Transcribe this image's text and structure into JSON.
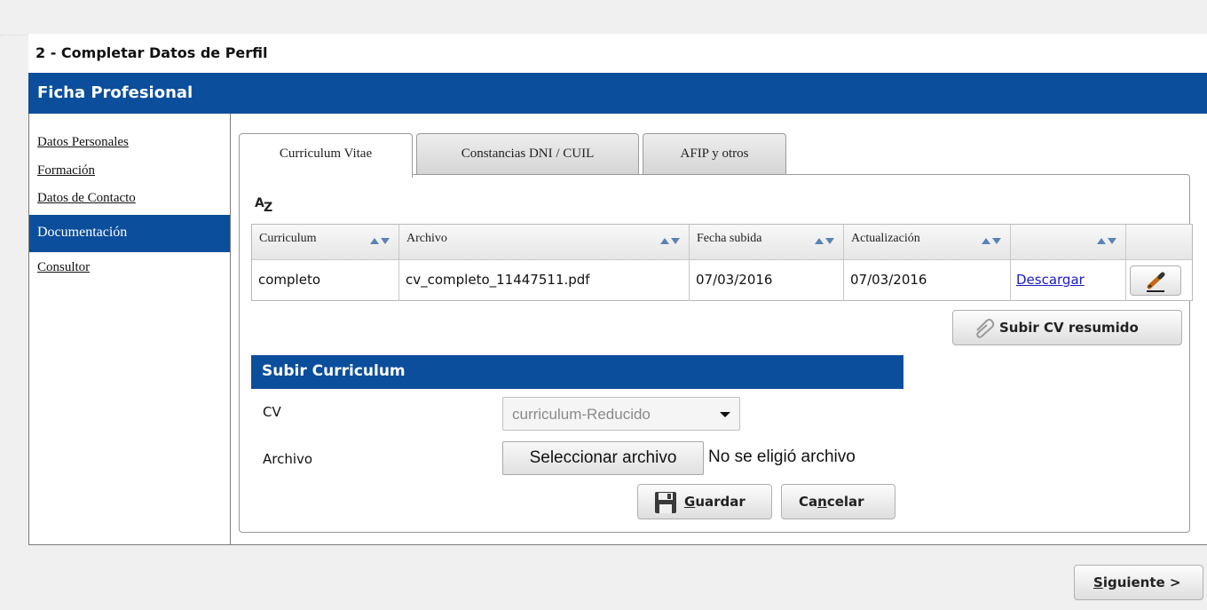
{
  "step": {
    "title": "2 - Completar Datos de Perfil"
  },
  "ficha": {
    "title": "Ficha Profesional"
  },
  "sidebar": {
    "items": [
      {
        "label": "Datos Personales",
        "active": false
      },
      {
        "label": "Formación",
        "active": false
      },
      {
        "label": "Datos de Contacto",
        "active": false
      },
      {
        "label": "Documentación",
        "active": true
      },
      {
        "label": "Consultor",
        "active": false
      }
    ]
  },
  "tabs": [
    {
      "label": "Curriculum Vitae",
      "active": true
    },
    {
      "label": "Constancias DNI / CUIL",
      "active": false
    },
    {
      "label": "AFIP y otros",
      "active": false
    }
  ],
  "grid": {
    "sort_icon": "az-sort-icon",
    "columns": [
      "Curriculum",
      "Archivo",
      "Fecha subida",
      "Actualización",
      "",
      ""
    ],
    "rows": [
      {
        "curriculum": "completo",
        "archivo": "cv_completo_11447511.pdf",
        "fecha_subida": "07/03/2016",
        "actualizacion": "07/03/2016",
        "descargar": "Descargar",
        "edit_icon": "pencil-icon"
      }
    ]
  },
  "subir_cv_resumido": {
    "label": "Subir CV resumido",
    "icon": "paperclip-icon"
  },
  "subir_curriculum": {
    "title": "Subir Curriculum",
    "cv_label": "CV",
    "cv_selected": "curriculum-Reducido",
    "archivo_label": "Archivo",
    "file_button": "Seleccionar archivo",
    "file_status": "No se eligió archivo"
  },
  "actions": {
    "guardar_prefix": "G",
    "guardar_rest": "uardar",
    "guardar_icon": "floppy-disk-icon",
    "cancelar_pre": "Ca",
    "cancelar_u": "n",
    "cancelar_post": "celar"
  },
  "siguiente": {
    "underline": "S",
    "rest": "iguiente >"
  },
  "colors": {
    "primary_blue": "#0b4e9c",
    "link_blue": "#1a1acc"
  }
}
